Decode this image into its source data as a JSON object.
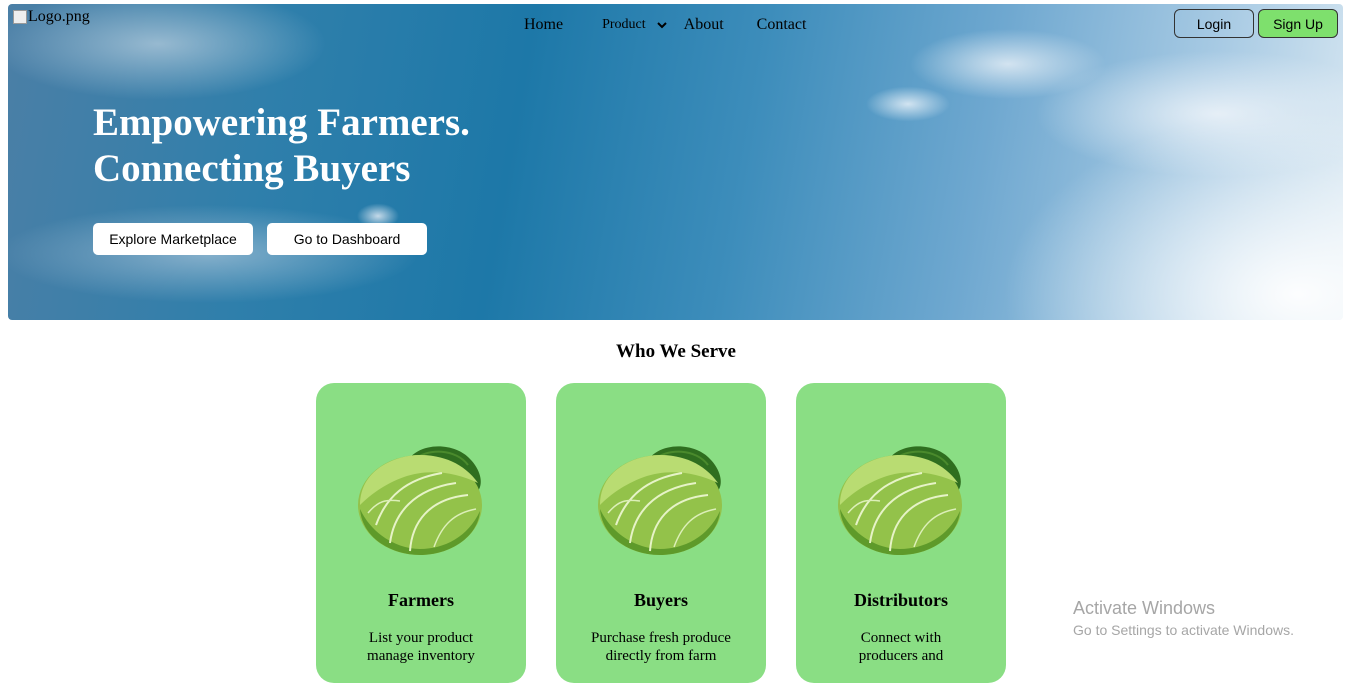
{
  "header": {
    "logo_alt": "Logo.png",
    "nav": {
      "home": "Home",
      "product": "Product",
      "about": "About",
      "contact": "Contact"
    },
    "login": "Login",
    "signup": "Sign Up"
  },
  "hero": {
    "line1": "Empowering Farmers.",
    "line2": "Connecting Buyers",
    "explore": "Explore Marketplace",
    "dashboard": "Go to Dashboard"
  },
  "section": {
    "title": "Who We Serve",
    "cards": [
      {
        "title": "Farmers",
        "desc": "List your product manage inventory"
      },
      {
        "title": "Buyers",
        "desc": "Purchase fresh produce directly from farm"
      },
      {
        "title": "Distributors",
        "desc": "Connect with producers and"
      }
    ]
  },
  "watermark": {
    "line1": "Activate Windows",
    "line2": "Go to Settings to activate Windows."
  },
  "colors": {
    "card_bg": "#8ade84",
    "signup_bg": "#7ee06d"
  }
}
